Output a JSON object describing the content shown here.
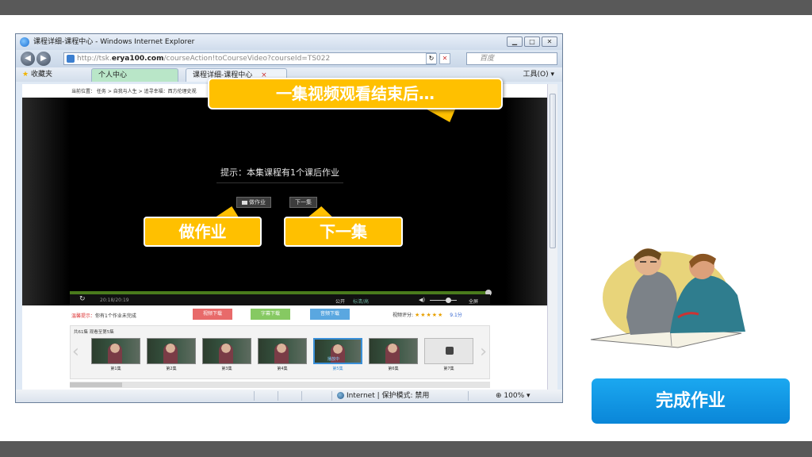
{
  "ie": {
    "title": "课程详细-课程中心 - Windows Internet Explorer",
    "url_prefix": "http://tsk.",
    "url_domain": "erya100.com",
    "url_suffix": "/courseAction!toCourseVideo?courseId=TS022",
    "search_placeholder": "百度",
    "favorites": "收藏夹",
    "tabs": [
      {
        "label": "个人中心"
      },
      {
        "label": "课程详细-课程中心"
      }
    ],
    "tab_close": "×",
    "tools": "工具(O)",
    "status_zone": "Internet | 保护模式: 禁用",
    "status_zoom": "100%"
  },
  "page": {
    "breadcrumb": "当前位置： 任务 > 自我与人生 > 追寻幸福：西方伦理史视",
    "player": {
      "hint": "提示：本集课程有1个课后作业",
      "homework_btn": "做作业",
      "next_btn": "下一集",
      "time": "20:18/20:19",
      "public": "公开",
      "hd": "标清/高",
      "fullscreen": "全屏",
      "progress": 1.0,
      "volume": 0.6
    },
    "reminder_label": "温馨提示：",
    "reminder_text": "你有1个作业未完成",
    "downloads": [
      "视频下载",
      "字幕下载",
      "音频下载"
    ],
    "rating_label": "视频评分:",
    "rating_stars": "★★★★★",
    "rating_score": "9.1分",
    "episodes_label": "共61集 观看至第5集",
    "episodes": [
      {
        "label": "第1集"
      },
      {
        "label": "第2集"
      },
      {
        "label": "第3集"
      },
      {
        "label": "第4集"
      },
      {
        "label": "第5集",
        "status": "播放中"
      },
      {
        "label": "第6集"
      },
      {
        "label": "第7集"
      }
    ]
  },
  "callouts": {
    "top": "一集视频观看结束后…",
    "homework": "做作业",
    "next": "下一集"
  },
  "done_button": "完成作业",
  "colors": {
    "callout": "#ffc000",
    "done_button": "#0a96e4",
    "frame_bar": "#595959"
  }
}
